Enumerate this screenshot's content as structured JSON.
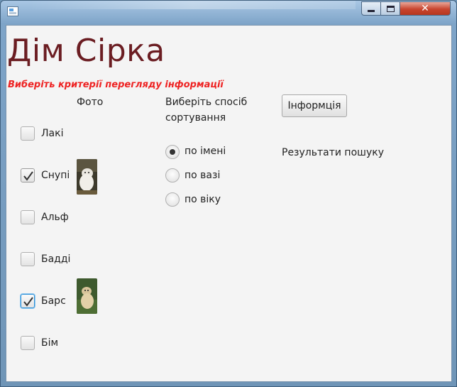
{
  "window": {
    "close_glyph": "✕"
  },
  "header": {
    "title": "Дім Сірка",
    "subtitle": "Виберіть критерії перегляду інформації"
  },
  "photo_column_label": "Фото",
  "dogs": [
    {
      "name": "Лакі",
      "checked": false
    },
    {
      "name": "Снупі",
      "checked": true
    },
    {
      "name": "Альф",
      "checked": false
    },
    {
      "name": "Бадді",
      "checked": false
    },
    {
      "name": "Барс",
      "checked": true,
      "focused": true
    },
    {
      "name": "Бім",
      "checked": false
    }
  ],
  "sort": {
    "label_line1": "Виберіть спосіб",
    "label_line2": "сортування",
    "options": [
      {
        "label": "по імені",
        "selected": true
      },
      {
        "label": "по вазі",
        "selected": false
      },
      {
        "label": "по віку",
        "selected": false
      }
    ]
  },
  "info_button_label": "Інформція",
  "results_label": "Результати пошуку",
  "colors": {
    "title": "#6b1d22",
    "subtitle": "#ee2222",
    "focus": "#2b8fd6"
  },
  "icons": {
    "app": "app-window-icon",
    "check": "checkmark-icon",
    "minimize": "minimize-icon",
    "maximize": "maximize-icon",
    "close": "close-icon"
  }
}
